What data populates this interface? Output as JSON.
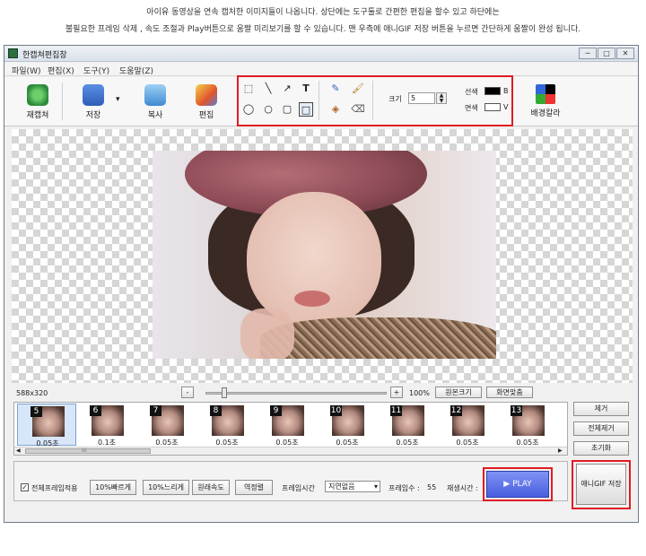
{
  "captions": {
    "line1": "아이유 동영상을 연속 캡처한 이미지들이 나옵니다.  상단에는 도구툴로 간편한 편집을 할수 있고 하단에는",
    "line2": "불필요한 프레임 삭제 , 속도 조절과  Play버튼으로 움짤 미리보기를 할 수 있습니다. 맨 우측에  애니GIF 저장 버튼을 누르면 간단하게 움짤이 완성 됩니다."
  },
  "window": {
    "title": "한캡쳐편집창",
    "controls": {
      "minimize": "─",
      "maximize": "□",
      "close": "✕"
    }
  },
  "menu": [
    "파일(W)",
    "편집(X)",
    "도구(Y)",
    "도움말(Z)"
  ],
  "toolbar": {
    "recapture": "재캡쳐",
    "save": "저장",
    "dropdown": "▾",
    "copy": "복사",
    "edit": "편집",
    "background_color": "배경칼라"
  },
  "draw_tools": {
    "select_rect": "⬚",
    "line": "╲",
    "arrow": "↗",
    "text": "T",
    "ellipse_select": "◯",
    "circle": "○",
    "rounded_rect": "▢",
    "rect": "□",
    "pen": "✎",
    "brush": "🖌",
    "fill": "◈",
    "eraser": "⌫"
  },
  "size": {
    "label": "크기",
    "value": "5"
  },
  "colors": {
    "line_label": "선색",
    "line_key": "B",
    "fill_label": "면색",
    "fill_key": "V"
  },
  "canvas": {
    "dimensions": "588x320"
  },
  "zoom": {
    "minus": "-",
    "plus": "+",
    "percent": "100%",
    "original_size": "원본크기",
    "fit_screen": "화면맞춤"
  },
  "frames": [
    {
      "num": "5",
      "duration": "0.05초"
    },
    {
      "num": "6",
      "duration": "0.1초"
    },
    {
      "num": "7",
      "duration": "0.05초"
    },
    {
      "num": "8",
      "duration": "0.05초"
    },
    {
      "num": "9",
      "duration": "0.05초"
    },
    {
      "num": "10",
      "duration": "0.05초"
    },
    {
      "num": "11",
      "duration": "0.05초"
    },
    {
      "num": "12",
      "duration": "0.05초"
    },
    {
      "num": "13",
      "duration": "0.05초"
    }
  ],
  "scroll": {
    "left": "◀",
    "right": "▶",
    "grip": "⁞⁞⁞"
  },
  "side_buttons": {
    "remove": "제거",
    "remove_all": "전체제거",
    "reset": "초기화"
  },
  "bottom": {
    "apply_all": "전체프레임적용",
    "faster": "10%빠르게",
    "slower": "10%느리게",
    "original_speed": "원래속도",
    "reverse": "역정렬",
    "frame_time_label": "프레임시간",
    "frame_time_value": "지연없음",
    "frame_count_label": "프레임수 :",
    "frame_count_value": "55",
    "play_time_label": "재생시간 :",
    "play": "▶  PLAY",
    "save_gif": "애니GIF 저장"
  },
  "accent": {
    "red_highlight": "#e01b24",
    "play_blue": "#4a5ee0"
  }
}
